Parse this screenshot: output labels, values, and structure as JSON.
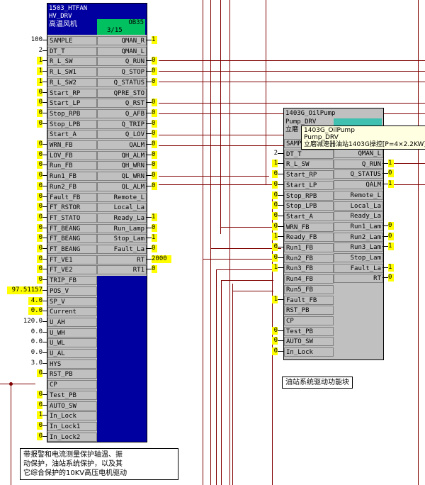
{
  "colors": {
    "wire": "#800000",
    "block_blue": "#0000a0",
    "value_yellow": "#ffff00",
    "header_green": "#00c060"
  },
  "left_block": {
    "id": "1503_HTFAN",
    "type": "HV_DRV",
    "desc": "高温风机",
    "ob": "OB35",
    "cycle": "3/15",
    "inputs": [
      {
        "label": "SAMPLE",
        "value": "100"
      },
      {
        "label": "DT_T",
        "value": "2"
      },
      {
        "label": "R_L_SW",
        "value": "1"
      },
      {
        "label": "R_L_SW1",
        "value": "1"
      },
      {
        "label": "R_L_SW2",
        "value": "1"
      },
      {
        "label": "Start_RP",
        "value": "0"
      },
      {
        "label": "Start_LP",
        "value": "0"
      },
      {
        "label": "Stop_RPB",
        "value": "0"
      },
      {
        "label": "Stop_LPB",
        "value": "0"
      },
      {
        "label": "Start_A",
        "value": ""
      },
      {
        "label": "WRN_FB",
        "value": "0"
      },
      {
        "label": "LOV_FB",
        "value": "0"
      },
      {
        "label": "Run_FB",
        "value": "0"
      },
      {
        "label": "Run1_FB",
        "value": "0"
      },
      {
        "label": "Run2_FB",
        "value": "0"
      },
      {
        "label": "Fault_FB",
        "value": "0"
      },
      {
        "label": "FT_RSTOR",
        "value": "0"
      },
      {
        "label": "FT_STATO",
        "value": "0"
      },
      {
        "label": "FT_BEANG",
        "value": "0"
      },
      {
        "label": "FT_BEANG",
        "value": "0"
      },
      {
        "label": "FT_BEANG",
        "value": "0"
      },
      {
        "label": "FT_VE1",
        "value": "0"
      },
      {
        "label": "FT_VE2",
        "value": "0"
      },
      {
        "label": "TRIP_FB",
        "value": "0"
      },
      {
        "label": "POS_V",
        "value": "97.51157"
      },
      {
        "label": "SP_V",
        "value": "4.0"
      },
      {
        "label": "Current",
        "value": "0.0"
      },
      {
        "label": "U_AH",
        "value": "120.0"
      },
      {
        "label": "U_WH",
        "value": "0.0"
      },
      {
        "label": "U_WL",
        "value": "0.0"
      },
      {
        "label": "U_AL",
        "value": "0.0"
      },
      {
        "label": "HYS",
        "value": "3.0"
      },
      {
        "label": "RST_PB",
        "value": "0"
      },
      {
        "label": "CP",
        "value": ""
      },
      {
        "label": "Test_PB",
        "value": "0"
      },
      {
        "label": "AUTO_SW",
        "value": "0"
      },
      {
        "label": "In_Lock",
        "value": "1"
      },
      {
        "label": "In_Lock1",
        "value": "0"
      },
      {
        "label": "In_Lock2",
        "value": "0"
      }
    ],
    "outputs": [
      {
        "label": "QMAN_R",
        "value": "1"
      },
      {
        "label": "QMAN_L",
        "value": ""
      },
      {
        "label": "Q_RUN",
        "value": "0"
      },
      {
        "label": "Q_STOP",
        "value": "0"
      },
      {
        "label": "Q_STATUS",
        "value": "0"
      },
      {
        "label": "QPRE_STO",
        "value": ""
      },
      {
        "label": "Q_RST",
        "value": "0"
      },
      {
        "label": "Q_AFB",
        "value": "0"
      },
      {
        "label": "Q_TRIP",
        "value": "0"
      },
      {
        "label": "Q_LOV",
        "value": "0"
      },
      {
        "label": "QALM",
        "value": "0"
      },
      {
        "label": "QH_ALM",
        "value": "0"
      },
      {
        "label": "QH_WRN",
        "value": "0"
      },
      {
        "label": "QL_WRN",
        "value": "0"
      },
      {
        "label": "QL_ALM",
        "value": "0"
      },
      {
        "label": "Remote_L",
        "value": ""
      },
      {
        "label": "Local_La",
        "value": ""
      },
      {
        "label": "Ready_La",
        "value": "1"
      },
      {
        "label": "Run_Lamp",
        "value": "0"
      },
      {
        "label": "Stop_Lam",
        "value": "1"
      },
      {
        "label": "Fault_La",
        "value": "0"
      },
      {
        "label": "RT",
        "value": "2000"
      },
      {
        "label": "RT1",
        "value": "0"
      }
    ]
  },
  "right_block": {
    "id": "1403G_OilPump",
    "type": "Pump_DRV",
    "desc": "立磨",
    "inputs": [
      {
        "label": "SAMP",
        "value": ""
      },
      {
        "label": "DT_T",
        "value": "2"
      },
      {
        "label": "R_L_SW",
        "value": "1"
      },
      {
        "label": "Start_RP",
        "value": "0"
      },
      {
        "label": "Start_LP",
        "value": "0"
      },
      {
        "label": "Stop_RPB",
        "value": "0"
      },
      {
        "label": "Stop_LPB",
        "value": "0"
      },
      {
        "label": "Start_A",
        "value": "0"
      },
      {
        "label": "WRN_FB",
        "value": "0"
      },
      {
        "label": "Ready_FB",
        "value": "1"
      },
      {
        "label": "Run1_FB",
        "value": "0"
      },
      {
        "label": "Run2_FB",
        "value": "0"
      },
      {
        "label": "Run3_FB",
        "value": "1"
      },
      {
        "label": "Run4_FB",
        "value": ""
      },
      {
        "label": "Run5_FB",
        "value": ""
      },
      {
        "label": "Fault_FB",
        "value": "1"
      },
      {
        "label": "RST_PB",
        "value": ""
      },
      {
        "label": "CP",
        "value": ""
      },
      {
        "label": "Test_PB",
        "value": "0"
      },
      {
        "label": "AUTO_SW",
        "value": "0"
      },
      {
        "label": "In_Lock",
        "value": "0"
      }
    ],
    "outputs": [
      {
        "label": "QMAN_L",
        "value": ""
      },
      {
        "label": "Q_RUN",
        "value": "1"
      },
      {
        "label": "Q_STATUS",
        "value": "0"
      },
      {
        "label": "QALM",
        "value": "1"
      },
      {
        "label": "Remote_L",
        "value": ""
      },
      {
        "label": "Local_La",
        "value": ""
      },
      {
        "label": "Ready_La",
        "value": ""
      },
      {
        "label": "Run1_Lam",
        "value": "0"
      },
      {
        "label": "Run2_Lam",
        "value": "0"
      },
      {
        "label": "Run3_Lam",
        "value": "1"
      },
      {
        "label": "Stop_Lam",
        "value": ""
      },
      {
        "label": "Fault_La",
        "value": "1"
      },
      {
        "label": "RT",
        "value": "0"
      }
    ]
  },
  "tooltip": {
    "line1": "1403G_OilPump",
    "line2": "Pump_DRV",
    "line3": "立磨减速器油站1403G操控[P=4×2.2KW]"
  },
  "label_right": "油站系统驱动功能块",
  "note_left": {
    "line1": "带报警和电流测量保护轴温、振",
    "line2": "动保护，油站系统保护，以及其",
    "line3": "它综合保护的10KV高压电机驱动"
  }
}
